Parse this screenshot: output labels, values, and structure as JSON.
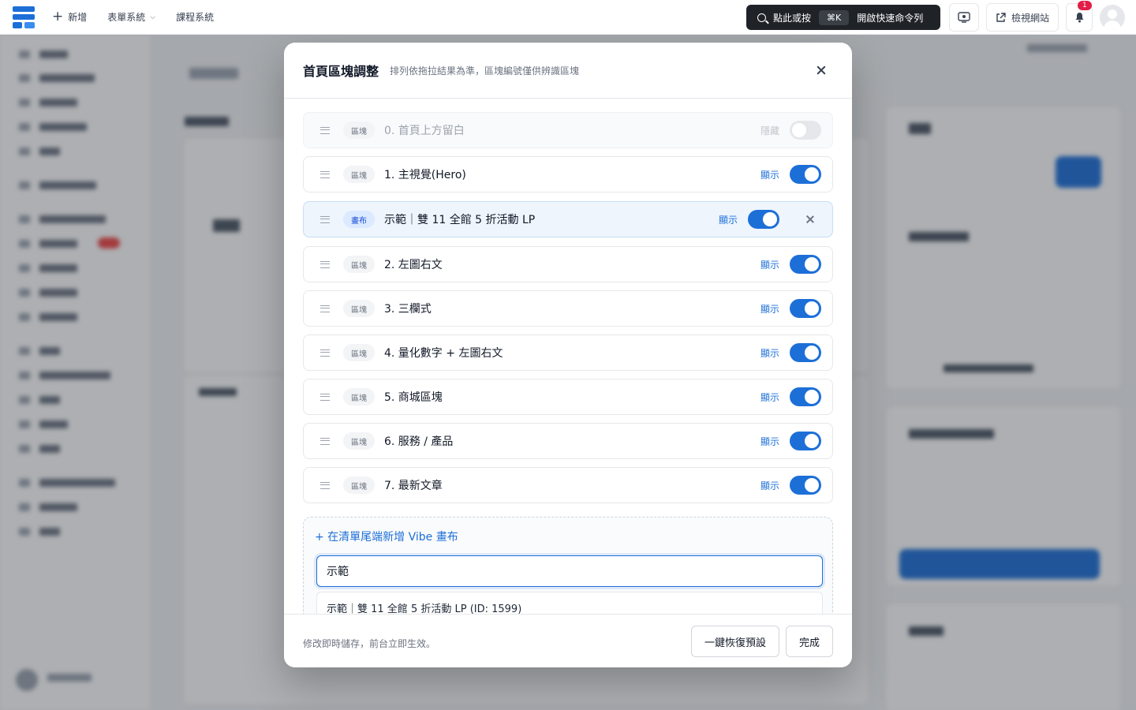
{
  "topbar": {
    "nav": [
      {
        "label": "新增",
        "icon": "plus-icon"
      },
      {
        "label": "表單系統",
        "icon": "chevron-down-icon"
      },
      {
        "label": "課程系統"
      }
    ],
    "command": {
      "prefix": "點此或按",
      "shortcut": "⌘K",
      "suffix": "開啟快速命令列",
      "icon": "search-icon"
    },
    "preview_icon": "preview-icon",
    "view_site": "檢視網站",
    "view_site_icon": "external-link-icon",
    "notifications": {
      "count": "1",
      "icon": "bell-icon"
    },
    "avatar_icon": "user-avatar-icon"
  },
  "modal": {
    "title": "首頁區塊調整",
    "subtitle": "排列依拖拉結果為準，區塊編號僅供辨識區塊",
    "close_icon": "close-icon",
    "rows": [
      {
        "tag": "區塊",
        "title": "0. 首頁上方留白",
        "status": "隱藏",
        "enabled": false
      },
      {
        "tag": "區塊",
        "title": "1. 主視覺(Hero)",
        "status": "顯示",
        "enabled": true
      },
      {
        "tag": "畫布",
        "title": "示範｜雙 11 全館 5 折活動 LP",
        "status": "顯示",
        "enabled": true,
        "removable": true
      },
      {
        "tag": "區塊",
        "title": "2. 左圖右文",
        "status": "顯示",
        "enabled": true
      },
      {
        "tag": "區塊",
        "title": "3. 三欄式",
        "status": "顯示",
        "enabled": true
      },
      {
        "tag": "區塊",
        "title": "4. 量化數字 + 左圖右文",
        "status": "顯示",
        "enabled": true
      },
      {
        "tag": "區塊",
        "title": "5. 商城區塊",
        "status": "顯示",
        "enabled": true
      },
      {
        "tag": "區塊",
        "title": "6. 服務 / 產品",
        "status": "顯示",
        "enabled": true
      },
      {
        "tag": "區塊",
        "title": "7. 最新文章",
        "status": "顯示",
        "enabled": true
      }
    ],
    "add": {
      "link": "+ 在清單尾端新增 Vibe 畫布",
      "input_value": "示範",
      "suggestion": "示範｜雙 11 全館 5 折活動 LP (ID: 1599)"
    },
    "footer": {
      "note": "修改即時儲存，前台立即生效。",
      "reset_label": "一鍵恢復預設",
      "done_label": "完成"
    }
  },
  "colors": {
    "accent": "#1d6fd8",
    "overlay": "rgba(40,44,52,0.38)"
  }
}
